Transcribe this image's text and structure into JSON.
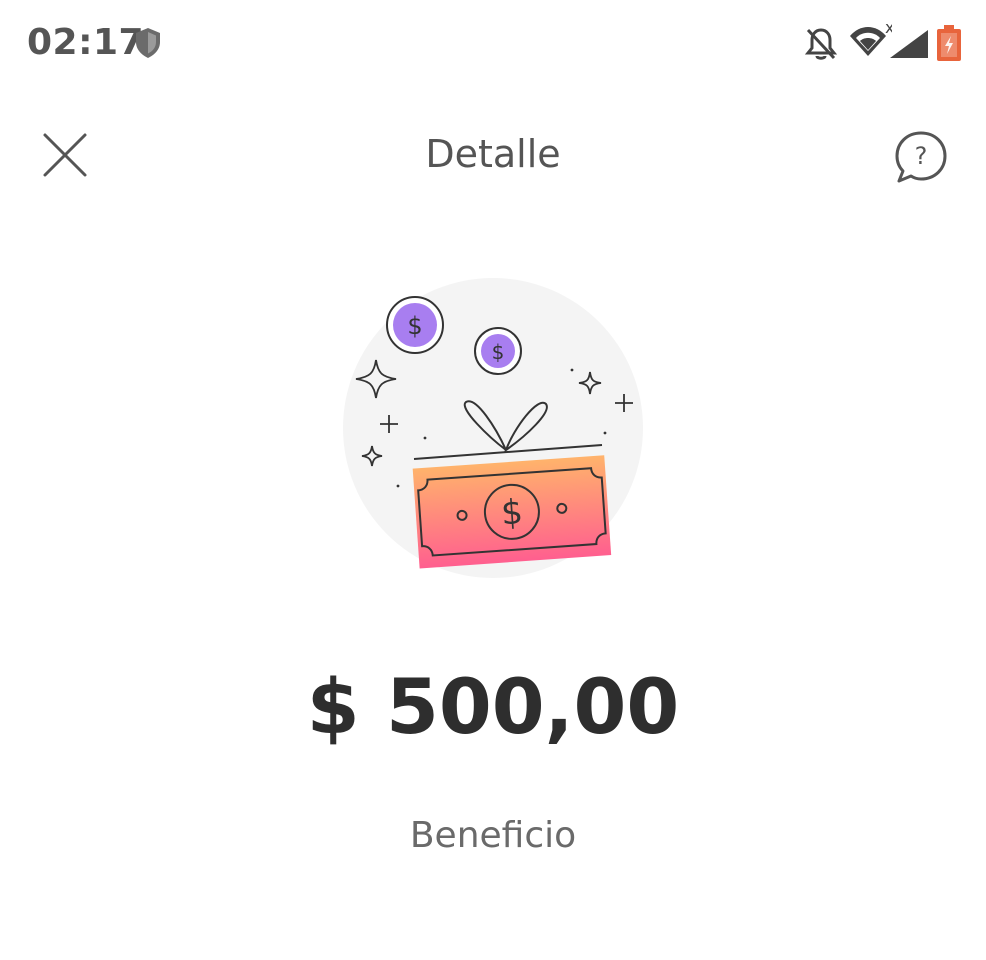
{
  "status_bar": {
    "time": "02:17",
    "icons": [
      "shield-icon",
      "bell-off-icon",
      "wifi-icon",
      "signal-icon",
      "battery-icon"
    ],
    "battery_color": "#e8643c"
  },
  "header": {
    "title": "Detalle",
    "close_icon": "close-icon",
    "help_icon": "help-icon"
  },
  "illustration": {
    "name": "gift-money-illustration",
    "coin_color": "#a87ef0",
    "bill_gradient": [
      "#ffb36b",
      "#ff5f8f"
    ]
  },
  "detail": {
    "amount": "$ 500,00",
    "label": "Beneficio"
  },
  "colors": {
    "text_primary": "#2e2e2e",
    "text_secondary": "#6a6a6a"
  }
}
